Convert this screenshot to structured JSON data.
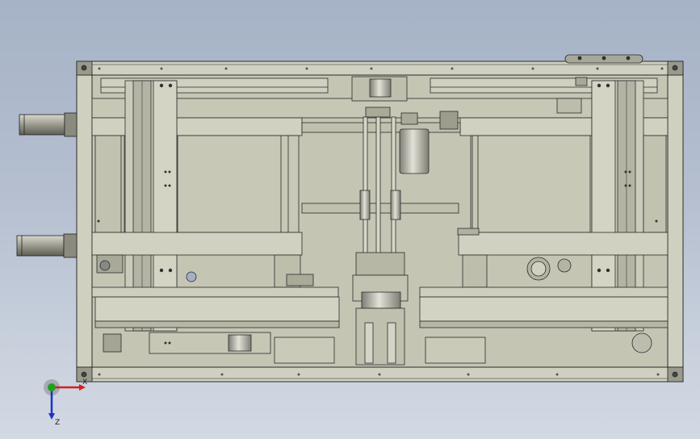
{
  "viewport": {
    "background_top": "#a6b2c6",
    "background_bottom": "#d3d9e3"
  },
  "model": {
    "frame_color": "#c9cab9",
    "part_color": "#b9baa8",
    "edge_color": "#2b2b2b",
    "shadow_color": "#8e8f7f"
  },
  "triad": {
    "x_label": "X",
    "z_label": "Z",
    "x_color": "#d42020",
    "y_color": "#20a020",
    "z_color": "#2030c8"
  }
}
